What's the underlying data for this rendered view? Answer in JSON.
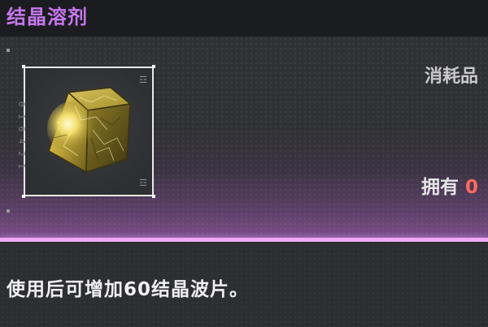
{
  "item": {
    "name": "结晶溶剂",
    "category": "消耗品",
    "owned_label": "拥有",
    "owned_count": "0",
    "description": "使用后可增加60结晶波片。",
    "icon": "crystal-cube-icon",
    "frame_code": "0 1 6 4 2 1",
    "frame_glyph": "☲"
  },
  "colors": {
    "title": "#c778ee",
    "accent_line": "#f0a9f6",
    "count": "#ff6a5e"
  }
}
